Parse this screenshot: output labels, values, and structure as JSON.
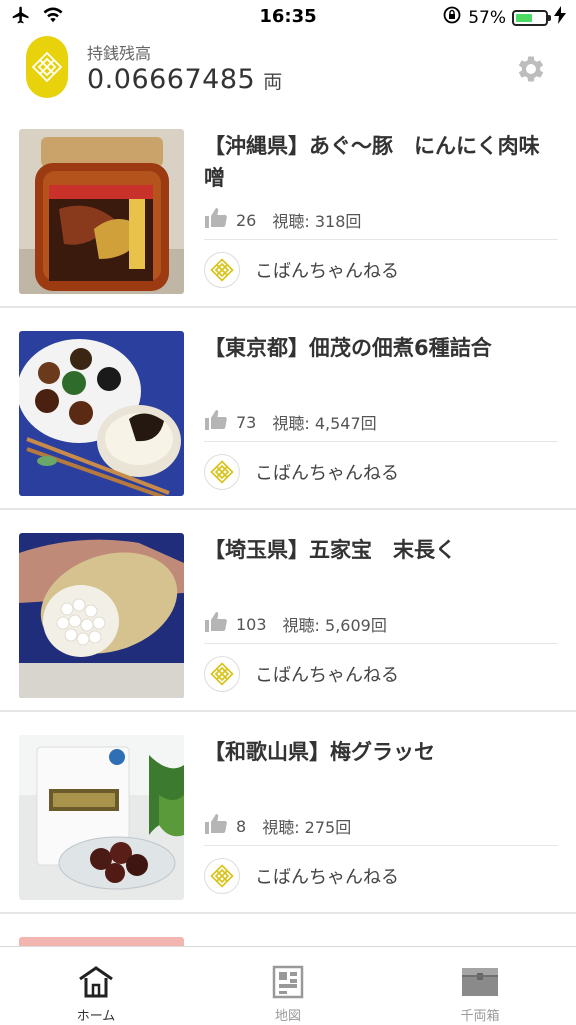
{
  "status_bar": {
    "time": "16:35",
    "battery_percent": "57%",
    "battery_level": 0.57
  },
  "header": {
    "balance_label": "持銭残高",
    "balance_value": "0.06667485",
    "balance_unit": "両"
  },
  "videos": [
    {
      "title": "【沖縄県】あぐ〜豚　にんにく肉味噌",
      "likes": "26",
      "views": "視聴: 318回",
      "channel": "こばんちゃんねる"
    },
    {
      "title": "【東京都】佃茂の佃煮6種詰合",
      "likes": "73",
      "views": "視聴: 4,547回",
      "channel": "こばんちゃんねる"
    },
    {
      "title": "【埼玉県】五家宝　末長く",
      "likes": "103",
      "views": "視聴: 5,609回",
      "channel": "こばんちゃんねる"
    },
    {
      "title": "【和歌山県】梅グラッセ",
      "likes": "8",
      "views": "視聴: 275回",
      "channel": "こばんちゃんねる"
    }
  ],
  "tabs": {
    "home": "ホーム",
    "map": "地図",
    "box": "千両箱"
  },
  "colors": {
    "accent_gold": "#e8d20c",
    "battery_green": "#4cd964"
  }
}
